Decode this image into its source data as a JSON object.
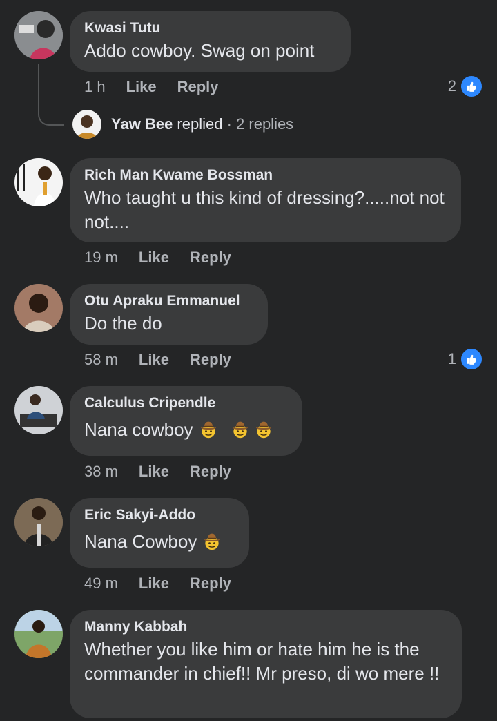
{
  "comments": [
    {
      "author": "Kwasi Tutu",
      "text": "Addo cowboy. Swag on point",
      "time": "1 h",
      "like": "Like",
      "reply": "Reply",
      "reactions": "2"
    },
    {
      "author": "Rich Man Kwame Bossman",
      "text": "Who taught u this kind of dressing?.....not not not....",
      "time": "19 m",
      "like": "Like",
      "reply": "Reply"
    },
    {
      "author": "Otu Apraku Emmanuel",
      "text": "Do the do",
      "time": "58 m",
      "like": "Like",
      "reply": "Reply",
      "reactions": "1"
    },
    {
      "author": "Calculus Cripendle",
      "text": "Nana cowboy",
      "time": "38 m",
      "like": "Like",
      "reply": "Reply"
    },
    {
      "author": "Eric Sakyi-Addo",
      "text": "Nana Cowboy",
      "time": "49 m",
      "like": "Like",
      "reply": "Reply"
    },
    {
      "author": "Manny Kabbah",
      "text": "Whether you like him or hate him he is the commander in chief!! Mr preso, di wo mere !!"
    }
  ],
  "reply_thread": {
    "name": "Yaw Bee",
    "action": "replied",
    "separator": "·",
    "count": "2 replies"
  },
  "colors": {
    "background": "#242526",
    "bubble": "#3a3b3c",
    "text": "#e4e6eb",
    "muted": "#b0b3b8",
    "like_blue": "#2d88ff"
  }
}
